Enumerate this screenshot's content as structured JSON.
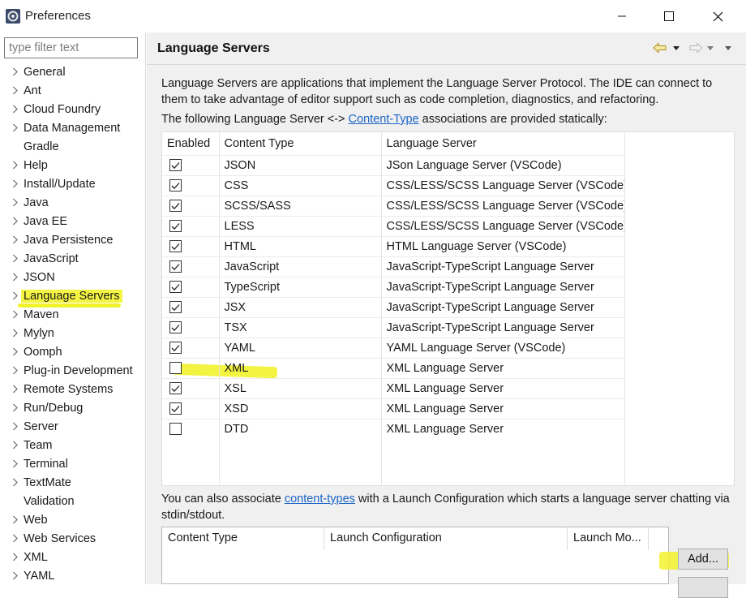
{
  "window": {
    "title": "Preferences",
    "icon": "eclipse-gear-icon",
    "controls": {
      "minimize": "minimize-icon",
      "maximize": "maximize-icon",
      "close": "close-icon"
    }
  },
  "left": {
    "filter_placeholder": "type filter text",
    "items": [
      {
        "label": "General",
        "expandable": true,
        "selected": false
      },
      {
        "label": "Ant",
        "expandable": true,
        "selected": false
      },
      {
        "label": "Cloud Foundry",
        "expandable": true,
        "selected": false
      },
      {
        "label": "Data Management",
        "expandable": true,
        "selected": false
      },
      {
        "label": "Gradle",
        "expandable": false,
        "selected": false
      },
      {
        "label": "Help",
        "expandable": true,
        "selected": false
      },
      {
        "label": "Install/Update",
        "expandable": true,
        "selected": false
      },
      {
        "label": "Java",
        "expandable": true,
        "selected": false
      },
      {
        "label": "Java EE",
        "expandable": true,
        "selected": false
      },
      {
        "label": "Java Persistence",
        "expandable": true,
        "selected": false
      },
      {
        "label": "JavaScript",
        "expandable": true,
        "selected": false
      },
      {
        "label": "JSON",
        "expandable": true,
        "selected": false
      },
      {
        "label": "Language Servers",
        "expandable": true,
        "selected": true
      },
      {
        "label": "Maven",
        "expandable": true,
        "selected": false
      },
      {
        "label": "Mylyn",
        "expandable": true,
        "selected": false
      },
      {
        "label": "Oomph",
        "expandable": true,
        "selected": false
      },
      {
        "label": "Plug-in Development",
        "expandable": true,
        "selected": false
      },
      {
        "label": "Remote Systems",
        "expandable": true,
        "selected": false
      },
      {
        "label": "Run/Debug",
        "expandable": true,
        "selected": false
      },
      {
        "label": "Server",
        "expandable": true,
        "selected": false
      },
      {
        "label": "Team",
        "expandable": true,
        "selected": false
      },
      {
        "label": "Terminal",
        "expandable": true,
        "selected": false
      },
      {
        "label": "TextMate",
        "expandable": true,
        "selected": false
      },
      {
        "label": "Validation",
        "expandable": false,
        "selected": false
      },
      {
        "label": "Web",
        "expandable": true,
        "selected": false
      },
      {
        "label": "Web Services",
        "expandable": true,
        "selected": false
      },
      {
        "label": "XML",
        "expandable": true,
        "selected": false
      },
      {
        "label": "YAML",
        "expandable": true,
        "selected": false
      }
    ]
  },
  "page": {
    "title": "Language Servers",
    "description": "Language Servers are applications that implement the Language Server Protocol. The IDE can connect to them to take advantage of editor support such as code completion, diagnostics, and refactoring.",
    "static_prefix": "The following Language Server <-> ",
    "static_link": "Content-Type",
    "static_suffix": " associations are provided statically:",
    "table": {
      "headers": [
        "Enabled",
        "Content Type",
        "Language Server"
      ],
      "rows": [
        {
          "enabled": true,
          "content_type": "JSON",
          "server": "JSon Language Server (VSCode)"
        },
        {
          "enabled": true,
          "content_type": "CSS",
          "server": "CSS/LESS/SCSS Language Server (VSCode)"
        },
        {
          "enabled": true,
          "content_type": "SCSS/SASS",
          "server": "CSS/LESS/SCSS Language Server (VSCode)"
        },
        {
          "enabled": true,
          "content_type": "LESS",
          "server": "CSS/LESS/SCSS Language Server (VSCode)"
        },
        {
          "enabled": true,
          "content_type": "HTML",
          "server": "HTML Language Server (VSCode)"
        },
        {
          "enabled": true,
          "content_type": "JavaScript",
          "server": "JavaScript-TypeScript Language Server"
        },
        {
          "enabled": true,
          "content_type": "TypeScript",
          "server": "JavaScript-TypeScript Language Server"
        },
        {
          "enabled": true,
          "content_type": "JSX",
          "server": "JavaScript-TypeScript Language Server"
        },
        {
          "enabled": true,
          "content_type": "TSX",
          "server": "JavaScript-TypeScript Language Server"
        },
        {
          "enabled": true,
          "content_type": "YAML",
          "server": "YAML Language Server (VSCode)"
        },
        {
          "enabled": false,
          "content_type": "XML",
          "server": "XML Language Server"
        },
        {
          "enabled": true,
          "content_type": "XSL",
          "server": "XML Language Server"
        },
        {
          "enabled": true,
          "content_type": "XSD",
          "server": "XML Language Server"
        },
        {
          "enabled": false,
          "content_type": "DTD",
          "server": "XML Language Server"
        }
      ]
    },
    "launch_prefix": "You can also associate ",
    "launch_link": "content-types",
    "launch_suffix": " with a Launch Configuration which starts a language server chatting via stdin/stdout.",
    "launch_table": {
      "headers": [
        "Content Type",
        "Launch Configuration",
        "Launch Mo..."
      ]
    },
    "add_button": "Add...",
    "highlight_color": "#f2f22e",
    "link_color": "#1c64c8"
  }
}
